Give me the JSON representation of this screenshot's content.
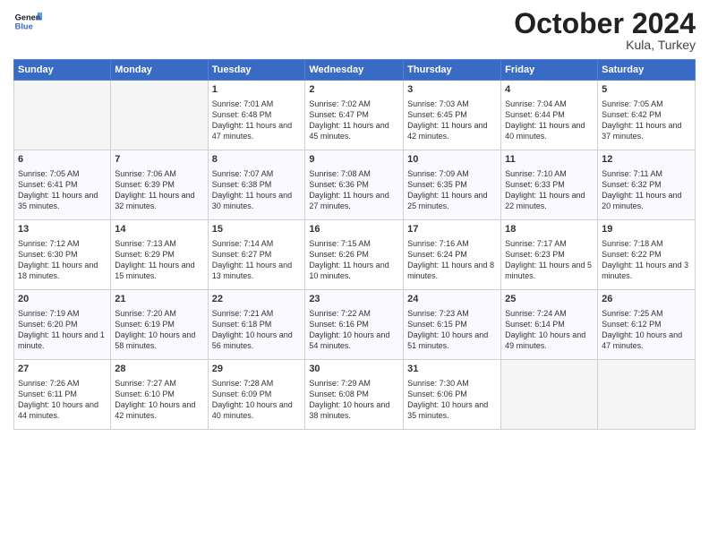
{
  "header": {
    "logo_line1": "General",
    "logo_line2": "Blue",
    "month": "October 2024",
    "location": "Kula, Turkey"
  },
  "days_of_week": [
    "Sunday",
    "Monday",
    "Tuesday",
    "Wednesday",
    "Thursday",
    "Friday",
    "Saturday"
  ],
  "weeks": [
    [
      {
        "day": "",
        "info": ""
      },
      {
        "day": "",
        "info": ""
      },
      {
        "day": "1",
        "info": "Sunrise: 7:01 AM\nSunset: 6:48 PM\nDaylight: 11 hours and 47 minutes."
      },
      {
        "day": "2",
        "info": "Sunrise: 7:02 AM\nSunset: 6:47 PM\nDaylight: 11 hours and 45 minutes."
      },
      {
        "day": "3",
        "info": "Sunrise: 7:03 AM\nSunset: 6:45 PM\nDaylight: 11 hours and 42 minutes."
      },
      {
        "day": "4",
        "info": "Sunrise: 7:04 AM\nSunset: 6:44 PM\nDaylight: 11 hours and 40 minutes."
      },
      {
        "day": "5",
        "info": "Sunrise: 7:05 AM\nSunset: 6:42 PM\nDaylight: 11 hours and 37 minutes."
      }
    ],
    [
      {
        "day": "6",
        "info": "Sunrise: 7:05 AM\nSunset: 6:41 PM\nDaylight: 11 hours and 35 minutes."
      },
      {
        "day": "7",
        "info": "Sunrise: 7:06 AM\nSunset: 6:39 PM\nDaylight: 11 hours and 32 minutes."
      },
      {
        "day": "8",
        "info": "Sunrise: 7:07 AM\nSunset: 6:38 PM\nDaylight: 11 hours and 30 minutes."
      },
      {
        "day": "9",
        "info": "Sunrise: 7:08 AM\nSunset: 6:36 PM\nDaylight: 11 hours and 27 minutes."
      },
      {
        "day": "10",
        "info": "Sunrise: 7:09 AM\nSunset: 6:35 PM\nDaylight: 11 hours and 25 minutes."
      },
      {
        "day": "11",
        "info": "Sunrise: 7:10 AM\nSunset: 6:33 PM\nDaylight: 11 hours and 22 minutes."
      },
      {
        "day": "12",
        "info": "Sunrise: 7:11 AM\nSunset: 6:32 PM\nDaylight: 11 hours and 20 minutes."
      }
    ],
    [
      {
        "day": "13",
        "info": "Sunrise: 7:12 AM\nSunset: 6:30 PM\nDaylight: 11 hours and 18 minutes."
      },
      {
        "day": "14",
        "info": "Sunrise: 7:13 AM\nSunset: 6:29 PM\nDaylight: 11 hours and 15 minutes."
      },
      {
        "day": "15",
        "info": "Sunrise: 7:14 AM\nSunset: 6:27 PM\nDaylight: 11 hours and 13 minutes."
      },
      {
        "day": "16",
        "info": "Sunrise: 7:15 AM\nSunset: 6:26 PM\nDaylight: 11 hours and 10 minutes."
      },
      {
        "day": "17",
        "info": "Sunrise: 7:16 AM\nSunset: 6:24 PM\nDaylight: 11 hours and 8 minutes."
      },
      {
        "day": "18",
        "info": "Sunrise: 7:17 AM\nSunset: 6:23 PM\nDaylight: 11 hours and 5 minutes."
      },
      {
        "day": "19",
        "info": "Sunrise: 7:18 AM\nSunset: 6:22 PM\nDaylight: 11 hours and 3 minutes."
      }
    ],
    [
      {
        "day": "20",
        "info": "Sunrise: 7:19 AM\nSunset: 6:20 PM\nDaylight: 11 hours and 1 minute."
      },
      {
        "day": "21",
        "info": "Sunrise: 7:20 AM\nSunset: 6:19 PM\nDaylight: 10 hours and 58 minutes."
      },
      {
        "day": "22",
        "info": "Sunrise: 7:21 AM\nSunset: 6:18 PM\nDaylight: 10 hours and 56 minutes."
      },
      {
        "day": "23",
        "info": "Sunrise: 7:22 AM\nSunset: 6:16 PM\nDaylight: 10 hours and 54 minutes."
      },
      {
        "day": "24",
        "info": "Sunrise: 7:23 AM\nSunset: 6:15 PM\nDaylight: 10 hours and 51 minutes."
      },
      {
        "day": "25",
        "info": "Sunrise: 7:24 AM\nSunset: 6:14 PM\nDaylight: 10 hours and 49 minutes."
      },
      {
        "day": "26",
        "info": "Sunrise: 7:25 AM\nSunset: 6:12 PM\nDaylight: 10 hours and 47 minutes."
      }
    ],
    [
      {
        "day": "27",
        "info": "Sunrise: 7:26 AM\nSunset: 6:11 PM\nDaylight: 10 hours and 44 minutes."
      },
      {
        "day": "28",
        "info": "Sunrise: 7:27 AM\nSunset: 6:10 PM\nDaylight: 10 hours and 42 minutes."
      },
      {
        "day": "29",
        "info": "Sunrise: 7:28 AM\nSunset: 6:09 PM\nDaylight: 10 hours and 40 minutes."
      },
      {
        "day": "30",
        "info": "Sunrise: 7:29 AM\nSunset: 6:08 PM\nDaylight: 10 hours and 38 minutes."
      },
      {
        "day": "31",
        "info": "Sunrise: 7:30 AM\nSunset: 6:06 PM\nDaylight: 10 hours and 35 minutes."
      },
      {
        "day": "",
        "info": ""
      },
      {
        "day": "",
        "info": ""
      }
    ]
  ]
}
